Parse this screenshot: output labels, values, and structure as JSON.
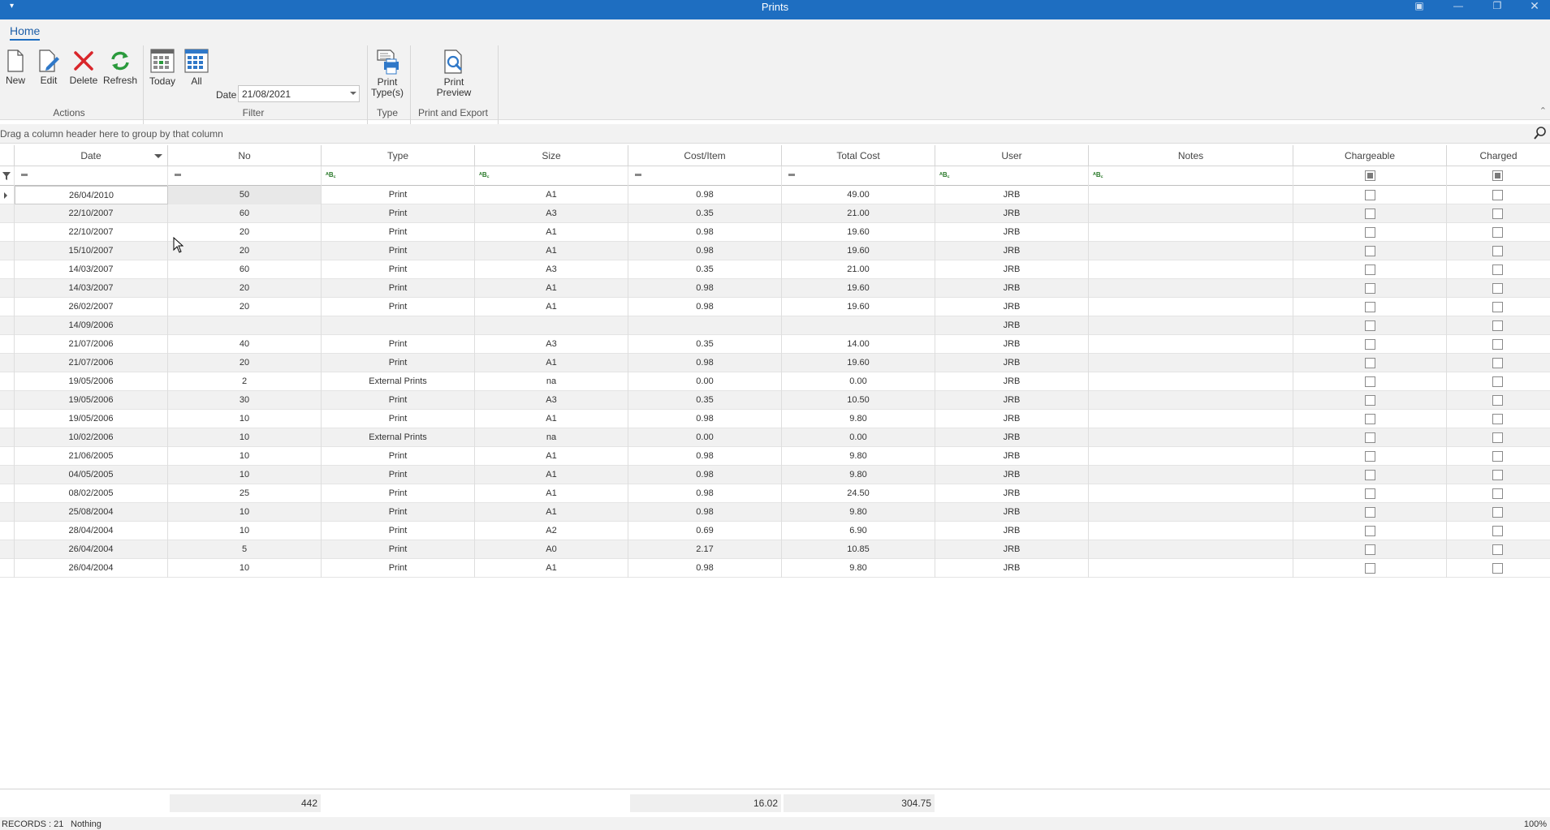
{
  "window": {
    "title": "Prints",
    "quick_access_icon": "chevron-down-icon"
  },
  "ribbon": {
    "tab": "Home",
    "actions": {
      "new_label": "New",
      "edit_label": "Edit",
      "delete_label": "Delete",
      "refresh_label": "Refresh",
      "group_label": "Actions"
    },
    "filter": {
      "today_label": "Today",
      "all_label": "All",
      "date_label": "Date",
      "date_value": "21/08/2021",
      "group_label": "Filter"
    },
    "type": {
      "print_types_label_1": "Print",
      "print_types_label_2": "Type(s)",
      "group_label": "Type"
    },
    "export": {
      "print_preview_label_1": "Print",
      "print_preview_label_2": "Preview",
      "group_label": "Print and Export"
    }
  },
  "grid": {
    "group_hint": "Drag a column header here to group by that column",
    "columns": [
      "Date",
      "No",
      "Type",
      "Size",
      "Cost/Item",
      "Total Cost",
      "User",
      "Notes",
      "Chargeable",
      "Charged"
    ],
    "rows": [
      {
        "date": "26/04/2010",
        "no": "50",
        "type": "Print",
        "size": "A1",
        "cost": "0.98",
        "total": "49.00",
        "user": "JRB",
        "notes": ""
      },
      {
        "date": "22/10/2007",
        "no": "60",
        "type": "Print",
        "size": "A3",
        "cost": "0.35",
        "total": "21.00",
        "user": "JRB",
        "notes": ""
      },
      {
        "date": "22/10/2007",
        "no": "20",
        "type": "Print",
        "size": "A1",
        "cost": "0.98",
        "total": "19.60",
        "user": "JRB",
        "notes": ""
      },
      {
        "date": "15/10/2007",
        "no": "20",
        "type": "Print",
        "size": "A1",
        "cost": "0.98",
        "total": "19.60",
        "user": "JRB",
        "notes": ""
      },
      {
        "date": "14/03/2007",
        "no": "60",
        "type": "Print",
        "size": "A3",
        "cost": "0.35",
        "total": "21.00",
        "user": "JRB",
        "notes": ""
      },
      {
        "date": "14/03/2007",
        "no": "20",
        "type": "Print",
        "size": "A1",
        "cost": "0.98",
        "total": "19.60",
        "user": "JRB",
        "notes": ""
      },
      {
        "date": "26/02/2007",
        "no": "20",
        "type": "Print",
        "size": "A1",
        "cost": "0.98",
        "total": "19.60",
        "user": "JRB",
        "notes": ""
      },
      {
        "date": "14/09/2006",
        "no": "",
        "type": "",
        "size": "",
        "cost": "",
        "total": "",
        "user": "JRB",
        "notes": ""
      },
      {
        "date": "21/07/2006",
        "no": "40",
        "type": "Print",
        "size": "A3",
        "cost": "0.35",
        "total": "14.00",
        "user": "JRB",
        "notes": ""
      },
      {
        "date": "21/07/2006",
        "no": "20",
        "type": "Print",
        "size": "A1",
        "cost": "0.98",
        "total": "19.60",
        "user": "JRB",
        "notes": ""
      },
      {
        "date": "19/05/2006",
        "no": "2",
        "type": "External Prints",
        "size": "na",
        "cost": "0.00",
        "total": "0.00",
        "user": "JRB",
        "notes": ""
      },
      {
        "date": "19/05/2006",
        "no": "30",
        "type": "Print",
        "size": "A3",
        "cost": "0.35",
        "total": "10.50",
        "user": "JRB",
        "notes": ""
      },
      {
        "date": "19/05/2006",
        "no": "10",
        "type": "Print",
        "size": "A1",
        "cost": "0.98",
        "total": "9.80",
        "user": "JRB",
        "notes": ""
      },
      {
        "date": "10/02/2006",
        "no": "10",
        "type": "External Prints",
        "size": "na",
        "cost": "0.00",
        "total": "0.00",
        "user": "JRB",
        "notes": ""
      },
      {
        "date": "21/06/2005",
        "no": "10",
        "type": "Print",
        "size": "A1",
        "cost": "0.98",
        "total": "9.80",
        "user": "JRB",
        "notes": ""
      },
      {
        "date": "04/05/2005",
        "no": "10",
        "type": "Print",
        "size": "A1",
        "cost": "0.98",
        "total": "9.80",
        "user": "JRB",
        "notes": ""
      },
      {
        "date": "08/02/2005",
        "no": "25",
        "type": "Print",
        "size": "A1",
        "cost": "0.98",
        "total": "24.50",
        "user": "JRB",
        "notes": ""
      },
      {
        "date": "25/08/2004",
        "no": "10",
        "type": "Print",
        "size": "A1",
        "cost": "0.98",
        "total": "9.80",
        "user": "JRB",
        "notes": ""
      },
      {
        "date": "28/04/2004",
        "no": "10",
        "type": "Print",
        "size": "A2",
        "cost": "0.69",
        "total": "6.90",
        "user": "JRB",
        "notes": ""
      },
      {
        "date": "26/04/2004",
        "no": "5",
        "type": "Print",
        "size": "A0",
        "cost": "2.17",
        "total": "10.85",
        "user": "JRB",
        "notes": ""
      },
      {
        "date": "26/04/2004",
        "no": "10",
        "type": "Print",
        "size": "A1",
        "cost": "0.98",
        "total": "9.80",
        "user": "JRB",
        "notes": ""
      }
    ]
  },
  "footer": {
    "sum_no": "442",
    "sum_cost": "16.02",
    "sum_total": "304.75"
  },
  "status": {
    "records": "RECORDS : 21",
    "selection": "Nothing",
    "zoom": "100%"
  },
  "colors": {
    "titlebar": "#1e6ec1",
    "delete_red": "#d9262b",
    "refresh_green": "#2a9a3c"
  }
}
